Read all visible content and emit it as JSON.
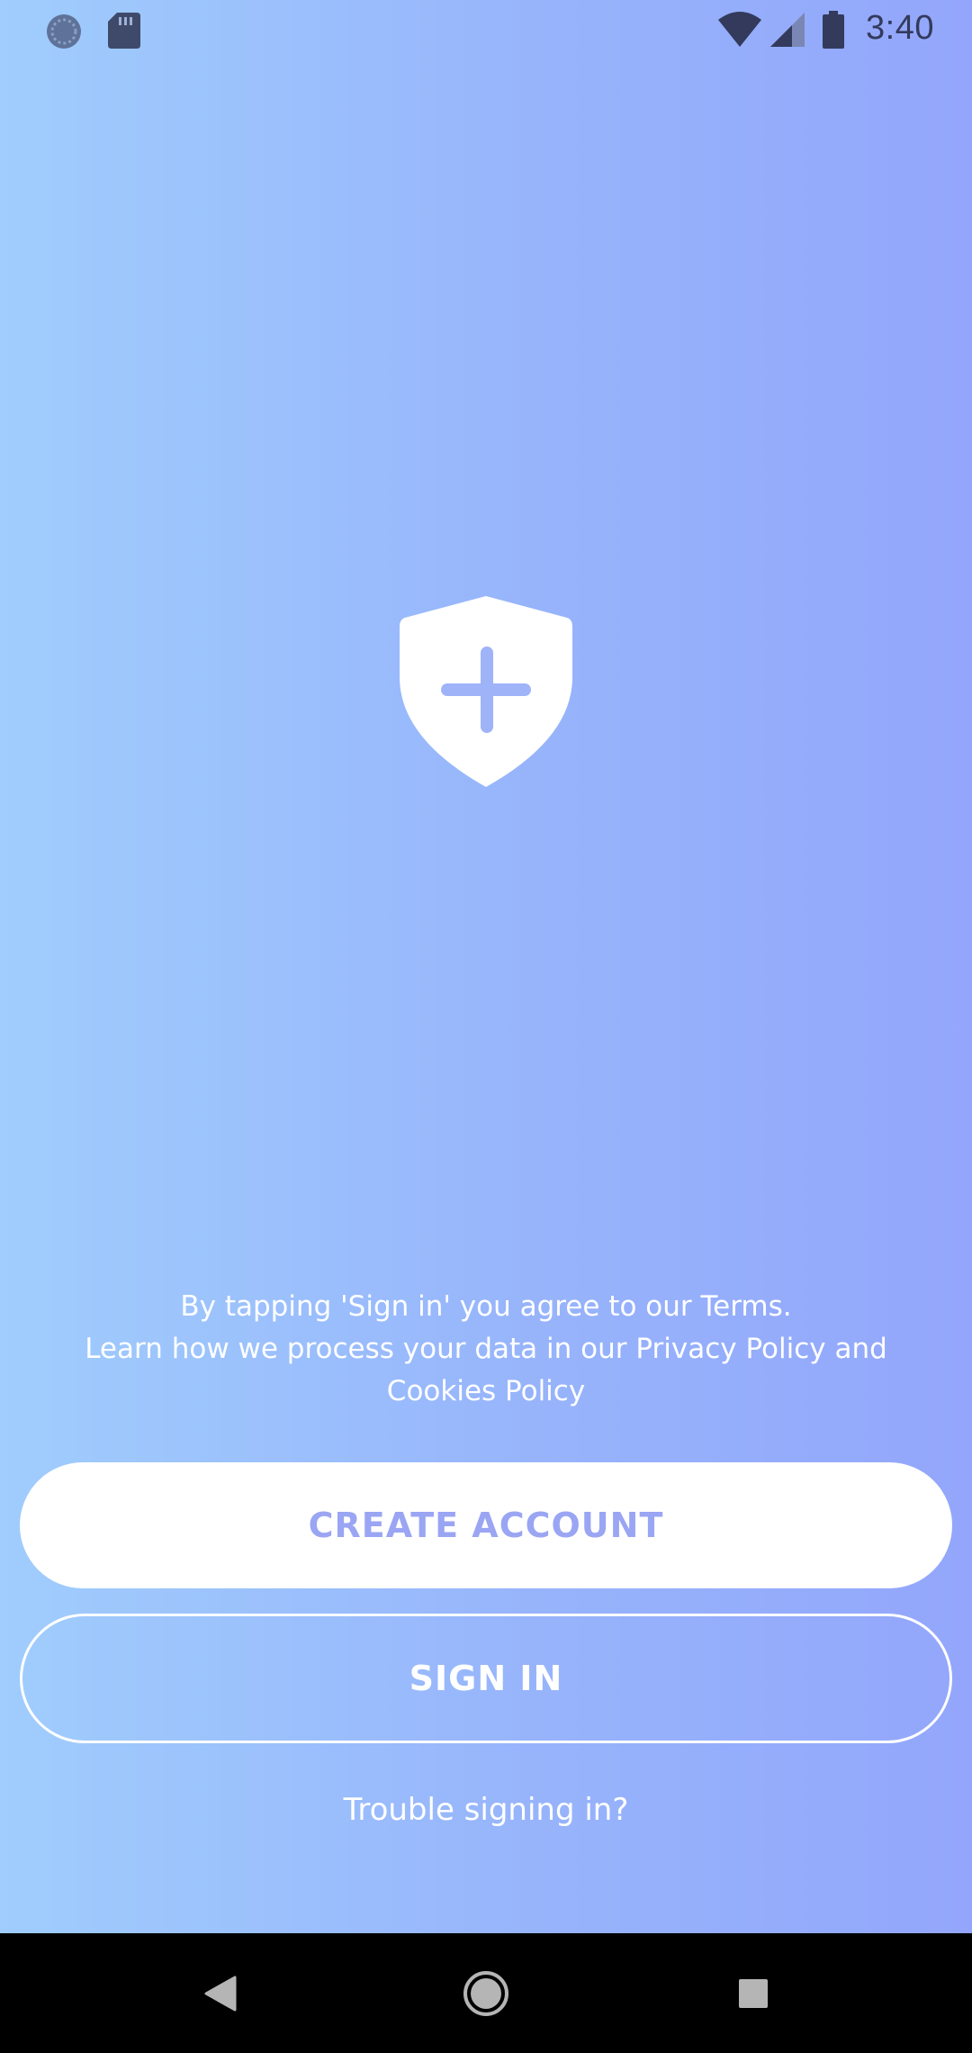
{
  "status_bar": {
    "time": "3:40",
    "left_icons": [
      "sync-icon",
      "sd-card-icon"
    ],
    "right_icons": [
      "wifi-icon",
      "cellular-signal-icon",
      "battery-icon"
    ]
  },
  "logo": {
    "icon": "shield-plus-icon"
  },
  "terms": {
    "line1": "By tapping 'Sign in' you agree to our Terms.",
    "line2": "Learn how we process your data in our Privacy Policy and",
    "line3": "Cookies Policy"
  },
  "buttons": {
    "create_account": "CREATE ACCOUNT",
    "sign_in": "SIGN IN"
  },
  "trouble_link": "Trouble signing in?",
  "nav_bar": {
    "icons": [
      "back-icon",
      "home-icon",
      "recents-icon"
    ]
  },
  "colors": {
    "gradient_left": "#a0cdfd",
    "gradient_right": "#93a6fb",
    "accent_text": "#9aa5f3",
    "white": "#ffffff"
  }
}
